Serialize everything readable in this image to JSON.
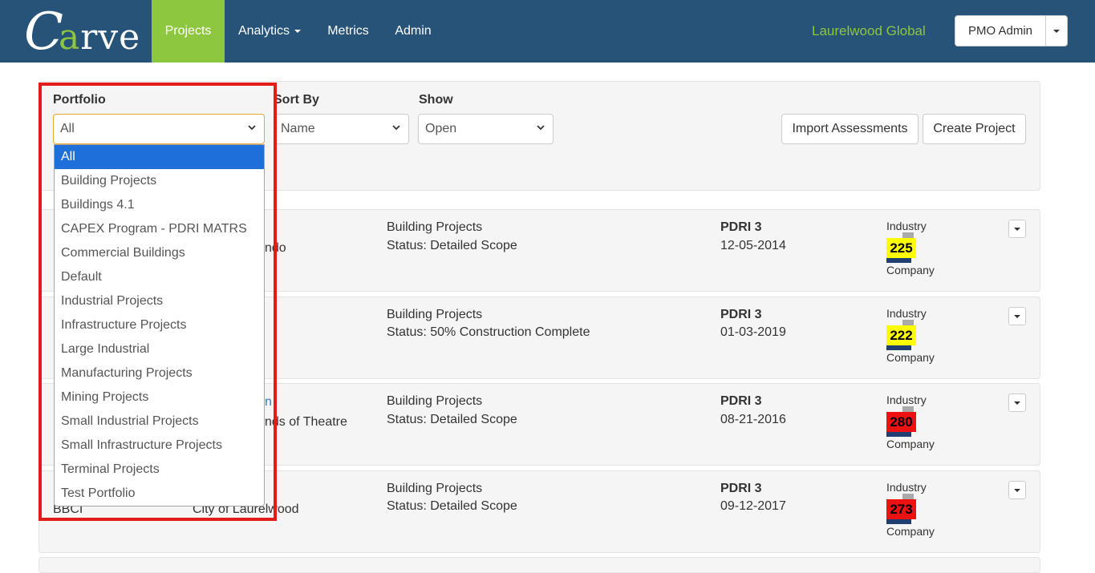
{
  "brand": {
    "logo_initial": "C",
    "logo_rest_a": "",
    "logo_accent": "a",
    "logo_rest_b": "rve"
  },
  "nav": {
    "projects": "Projects",
    "analytics": "Analytics",
    "metrics": "Metrics",
    "admin": "Admin"
  },
  "org_name": "Laurelwood Global",
  "user_menu": {
    "label": "PMO Admin"
  },
  "filters": {
    "portfolio_label": "Portfolio",
    "portfolio_value": "All",
    "sort_label": "Sort By",
    "sort_value": "Name",
    "show_label": "Show",
    "show_value": "Open"
  },
  "actions": {
    "import": "Import Assessments",
    "create": "Create Project"
  },
  "portfolio_options": [
    "All",
    "Building Projects",
    "Buildings 4.1",
    "CAPEX Program - PDRI MATRS",
    "Commercial Buildings",
    "Default",
    "Industrial Projects",
    "Infrastructure Projects",
    "Large Industrial",
    "Manufacturing Projects",
    "Mining Projects",
    "Small Industrial Projects",
    "Small Infrastructure Projects",
    "Terminal Projects",
    "Test Portfolio"
  ],
  "projects": [
    {
      "left_partial": "",
      "mid_partial": "ndo",
      "portfolio": "Building Projects",
      "status": "Status: Detailed Scope",
      "pdri": "PDRI 3",
      "date": "12-05-2014",
      "industry": "Industry",
      "score": "225",
      "score_color": "#ffff00",
      "company": "Company"
    },
    {
      "left_partial": "",
      "mid_partial": "",
      "portfolio": "Building Projects",
      "status": "Status: 50% Construction Complete",
      "pdri": "PDRI 3",
      "date": "01-03-2019",
      "industry": "Industry",
      "score": "222",
      "score_color": "#ffff00",
      "company": "Company"
    },
    {
      "left_partial": "",
      "mid_link": "n",
      "mid_partial": "nds of Theatre",
      "portfolio": "Building Projects",
      "status": "Status: Detailed Scope",
      "pdri": "PDRI 3",
      "date": "08-21-2016",
      "industry": "Industry",
      "score": "280",
      "score_color": "#ee1111",
      "company": "Company"
    },
    {
      "left_partial": "BBCI",
      "mid_partial": "City of Laurelwood",
      "portfolio": "Building Projects",
      "status": "Status: Detailed Scope",
      "pdri": "PDRI 3",
      "date": "09-12-2017",
      "industry": "Industry",
      "score": "273",
      "score_color": "#ee1111",
      "company": "Company"
    }
  ],
  "colors": {
    "navbar": "#265377",
    "accent": "#8dc63f",
    "highlight": "#e31b1b",
    "selected_option": "#1e6fd9"
  }
}
